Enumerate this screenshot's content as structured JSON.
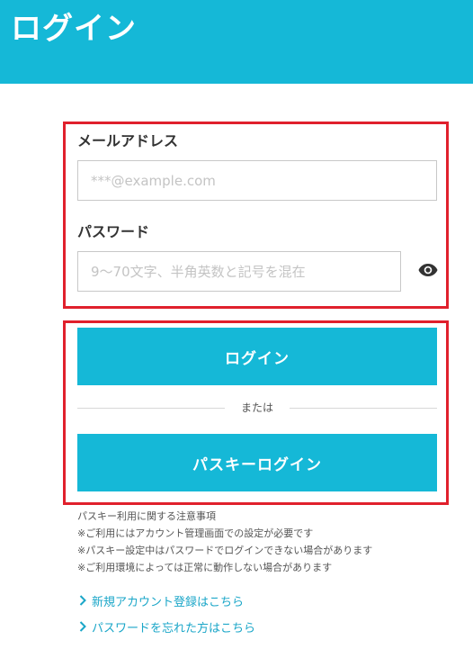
{
  "header": {
    "title": "ログイン"
  },
  "form": {
    "email_label": "メールアドレス",
    "email_placeholder": "***@example.com",
    "password_label": "パスワード",
    "password_placeholder": "9〜70文字、半角英数と記号を混在"
  },
  "buttons": {
    "login_label": "ログイン",
    "or_text": "または",
    "passkey_label": "パスキーログイン"
  },
  "notes": {
    "title": "パスキー利用に関する注意事項",
    "items": [
      "※ご利用にはアカウント管理画面での設定が必要です",
      "※パスキー設定中はパスワードでログインできない場合があります",
      "※ご利用環境によっては正常に動作しない場合があります"
    ]
  },
  "links": {
    "signup": "新規アカウント登録はこちら",
    "forgot_password": "パスワードを忘れた方はこちら"
  },
  "icons": {
    "password_toggle": "eye-icon",
    "link_arrow": "chevron-right-icon"
  },
  "colors": {
    "brand": "#15b8d7",
    "highlight_border": "#e0202c",
    "link": "#1aa6c8"
  }
}
